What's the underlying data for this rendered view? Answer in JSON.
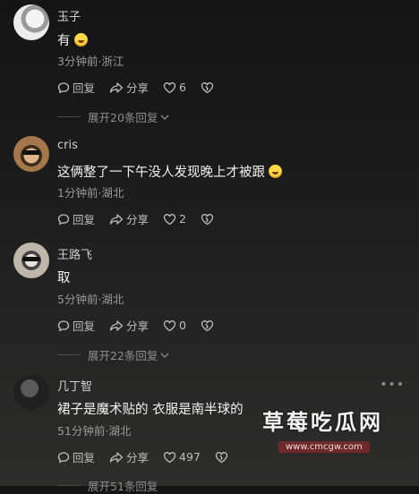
{
  "comments": [
    {
      "name": "玉子",
      "text": "有",
      "meta": "3分钟前·浙江",
      "reply": "回复",
      "share": "分享",
      "likes": "6",
      "expand": "展开20条回复"
    },
    {
      "name": "cris",
      "text": "这俩整了一下午没人发现晚上才被跟",
      "meta": "1分钟前·湖北",
      "reply": "回复",
      "share": "分享",
      "likes": "2"
    },
    {
      "name": "王路飞",
      "text": "取",
      "meta": "5分钟前·湖北",
      "reply": "回复",
      "share": "分享",
      "likes": "0",
      "expand": "展开22条回复"
    },
    {
      "name": "几丁智",
      "text": "裙子是魔术贴的 衣服是南半球的",
      "meta": "51分钟前·湖北",
      "reply": "回复",
      "share": "分享",
      "likes": "497",
      "expand": "展开51条回复"
    }
  ],
  "more_icon": "more-dots-icon",
  "watermark": {
    "title": "草莓吃瓜网",
    "url": "www.cmcgw.com"
  }
}
